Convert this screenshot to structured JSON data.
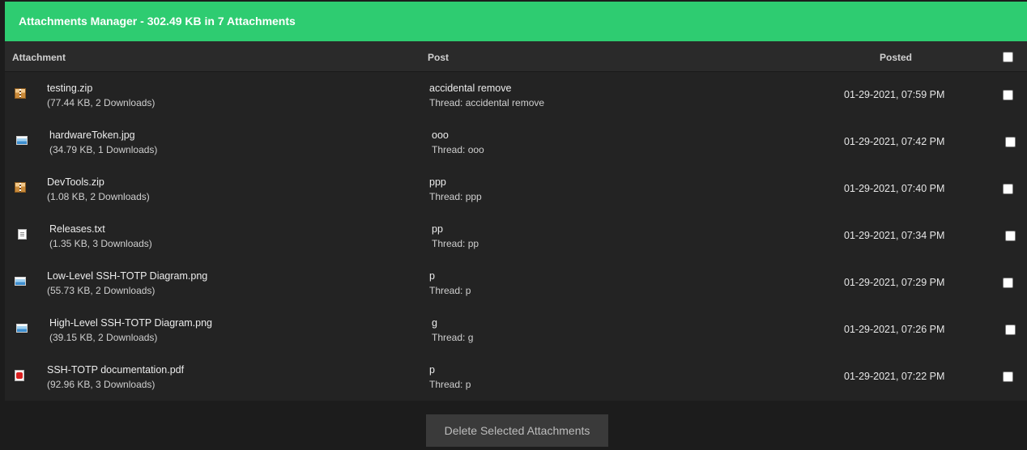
{
  "header": {
    "title": "Attachments Manager - 302.49 KB in 7 Attachments"
  },
  "columns": {
    "attachment": "Attachment",
    "post": "Post",
    "posted": "Posted"
  },
  "rows": [
    {
      "icon": "zip-icon",
      "name": "testing.zip",
      "meta": "(77.44 KB, 2 Downloads)",
      "post": "accidental remove",
      "thread": "Thread: accidental remove",
      "posted": "01-29-2021, 07:59 PM"
    },
    {
      "icon": "image-icon",
      "name": "hardwareToken.jpg",
      "meta": "(34.79 KB, 1 Downloads)",
      "post": "ooo",
      "thread": "Thread: ooo",
      "posted": "01-29-2021, 07:42 PM"
    },
    {
      "icon": "zip-icon",
      "name": "DevTools.zip",
      "meta": "(1.08 KB, 2 Downloads)",
      "post": "ppp",
      "thread": "Thread: ppp",
      "posted": "01-29-2021, 07:40 PM"
    },
    {
      "icon": "text-file-icon",
      "name": "Releases.txt",
      "meta": "(1.35 KB, 3 Downloads)",
      "post": "pp",
      "thread": "Thread: pp",
      "posted": "01-29-2021, 07:34 PM"
    },
    {
      "icon": "image-icon",
      "name": "Low-Level SSH-TOTP Diagram.png",
      "meta": "(55.73 KB, 2 Downloads)",
      "post": "p",
      "thread": "Thread: p",
      "posted": "01-29-2021, 07:29 PM"
    },
    {
      "icon": "image-icon",
      "name": "High-Level SSH-TOTP Diagram.png",
      "meta": "(39.15 KB, 2 Downloads)",
      "post": "g",
      "thread": "Thread: g",
      "posted": "01-29-2021, 07:26 PM"
    },
    {
      "icon": "pdf-icon",
      "name": "SSH-TOTP documentation.pdf",
      "meta": "(92.96 KB, 3 Downloads)",
      "post": "p",
      "thread": "Thread: p",
      "posted": "01-29-2021, 07:22 PM"
    }
  ],
  "footer": {
    "delete_label": "Delete Selected Attachments"
  },
  "colors": {
    "header_bg": "#2ecc71",
    "row_bg": "#232323",
    "page_bg": "#1c1c1c"
  }
}
